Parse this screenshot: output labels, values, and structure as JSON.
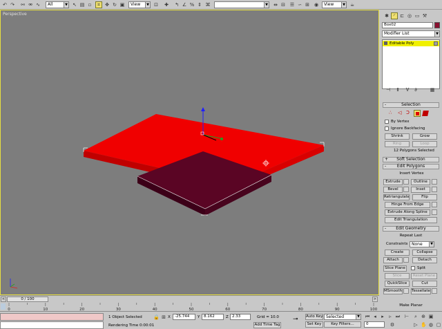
{
  "toolbar": {
    "filter_value": "All",
    "refcoord_value": "View",
    "refcoord2_value": "View"
  },
  "viewport": {
    "label": "Perspective"
  },
  "command_panel": {
    "object_name": "Box02",
    "object_color": "#8a1030",
    "modifier_list": "Modifier List",
    "stack_item": "Editable Poly",
    "selection": {
      "title": "Selection",
      "by_vertex": "By Vertex",
      "ignore_backfacing": "Ignore Backfacing",
      "shrink": "Shrink",
      "grow": "Grow",
      "ring": "Ring",
      "loop": "Loop",
      "status": "12 Polygons Selected"
    },
    "soft_selection": {
      "title": "Soft Selection"
    },
    "edit_polygons": {
      "title": "Edit Polygons",
      "insert_vertex": "Insert Vertex",
      "extrude": "Extrude",
      "outline": "Outline",
      "bevel": "Bevel",
      "inset": "Inset",
      "retriangulate": "Retriangulate",
      "flip": "Flip",
      "hinge_from_edge": "Hinge From Edge",
      "extrude_along_spline": "Extrude Along Spline",
      "edit_triangulation": "Edit Triangulation"
    },
    "edit_geometry": {
      "title": "Edit Geometry",
      "repeat_last": "Repeat Last",
      "constraints_label": "Constraints",
      "constraints_value": "None",
      "create": "Create",
      "collapse": "Collapse",
      "attach": "Attach",
      "detach": "Detach",
      "slice_plane": "Slice Plane",
      "split": "Split",
      "slice": "Slice",
      "reset_plane": "Reset Plane",
      "quickslice": "QuickSlice",
      "cut": "Cut",
      "msmooth": "MSmooth",
      "tessellate": "Tessellate",
      "make_planar": "Make Planar"
    }
  },
  "timeline": {
    "frame_readout": "0 / 100",
    "ticks": [
      "0",
      "10",
      "20",
      "30",
      "40",
      "50",
      "60",
      "70",
      "80",
      "90",
      "100"
    ]
  },
  "status": {
    "selected": "1 Object Selected",
    "rendering_time": "Rendering Time  0:00:01",
    "x_label": "X",
    "x_value": "-25.744",
    "y_label": "Y",
    "y_value": "8.162",
    "z_label": "Z",
    "z_value": "2.33",
    "grid": "Grid = 10.0",
    "add_time_tag": "Add Time Tag",
    "auto_key": "Auto Key",
    "auto_key_value": "Selected",
    "set_key": "Set Key",
    "key_filters": "Key Filters...",
    "frame_value": "0"
  }
}
